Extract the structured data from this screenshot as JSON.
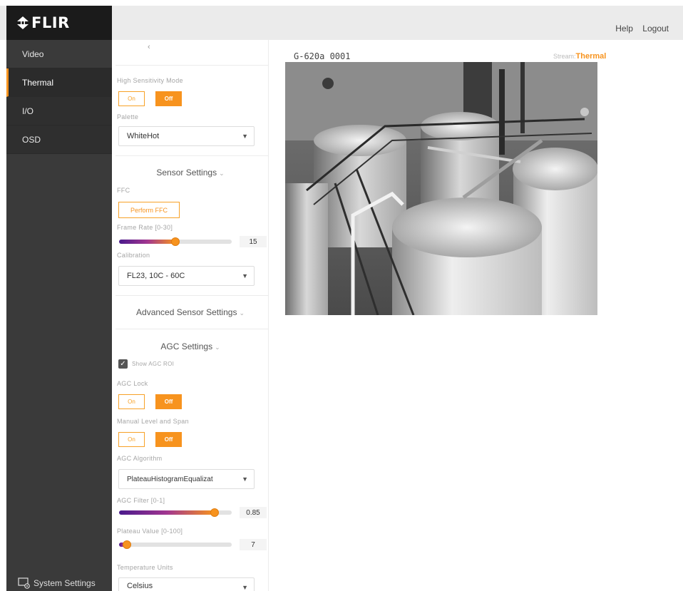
{
  "brand": {
    "logo_text": "FLIR"
  },
  "header": {
    "help": "Help",
    "logout": "Logout"
  },
  "nav": {
    "items": [
      {
        "label": "Video"
      },
      {
        "label": "Thermal"
      },
      {
        "label": "I/O"
      },
      {
        "label": "OSD"
      }
    ],
    "active": "Thermal",
    "system_settings": "System Settings"
  },
  "panel": {
    "high_sensitivity": {
      "label": "High Sensitivity Mode",
      "on": "On",
      "off": "Off",
      "selected": "Off"
    },
    "palette": {
      "label": "Palette",
      "value": "WhiteHot"
    },
    "sensor_settings": {
      "title": "Sensor Settings"
    },
    "ffc": {
      "label": "FFC",
      "button": "Perform FFC"
    },
    "frame_rate": {
      "label": "Frame Rate [0-30]",
      "value": "15",
      "fraction": 0.5
    },
    "calibration": {
      "label": "Calibration",
      "value": "FL23, 10C - 60C"
    },
    "advanced_sensor_settings": {
      "title": "Advanced Sensor Settings"
    },
    "agc_settings": {
      "title": "AGC Settings"
    },
    "show_agc_roi": {
      "label": "Show AGC ROI",
      "checked": true
    },
    "agc_lock": {
      "label": "AGC Lock",
      "on": "On",
      "off": "Off",
      "selected": "Off"
    },
    "manual_level_span": {
      "label": "Manual Level and Span",
      "on": "On",
      "off": "Off",
      "selected": "Off"
    },
    "agc_algorithm": {
      "label": "AGC Algorithm",
      "value": "PlateauHistogramEqualizat"
    },
    "agc_filter": {
      "label": "AGC Filter [0-1]",
      "value": "0.85",
      "fraction": 0.85
    },
    "plateau_value": {
      "label": "Plateau Value [0-100]",
      "value": "7",
      "fraction": 0.07
    },
    "temperature_units": {
      "label": "Temperature Units",
      "value": "Celsius"
    }
  },
  "stream": {
    "camera_name": "G-620a 0001",
    "stream_label": "Stream:",
    "stream_value": "Thermal"
  },
  "colors": {
    "accent": "#f7931e",
    "sidebar": "#3a3a3a",
    "logo_bg": "#1b1b1b"
  }
}
